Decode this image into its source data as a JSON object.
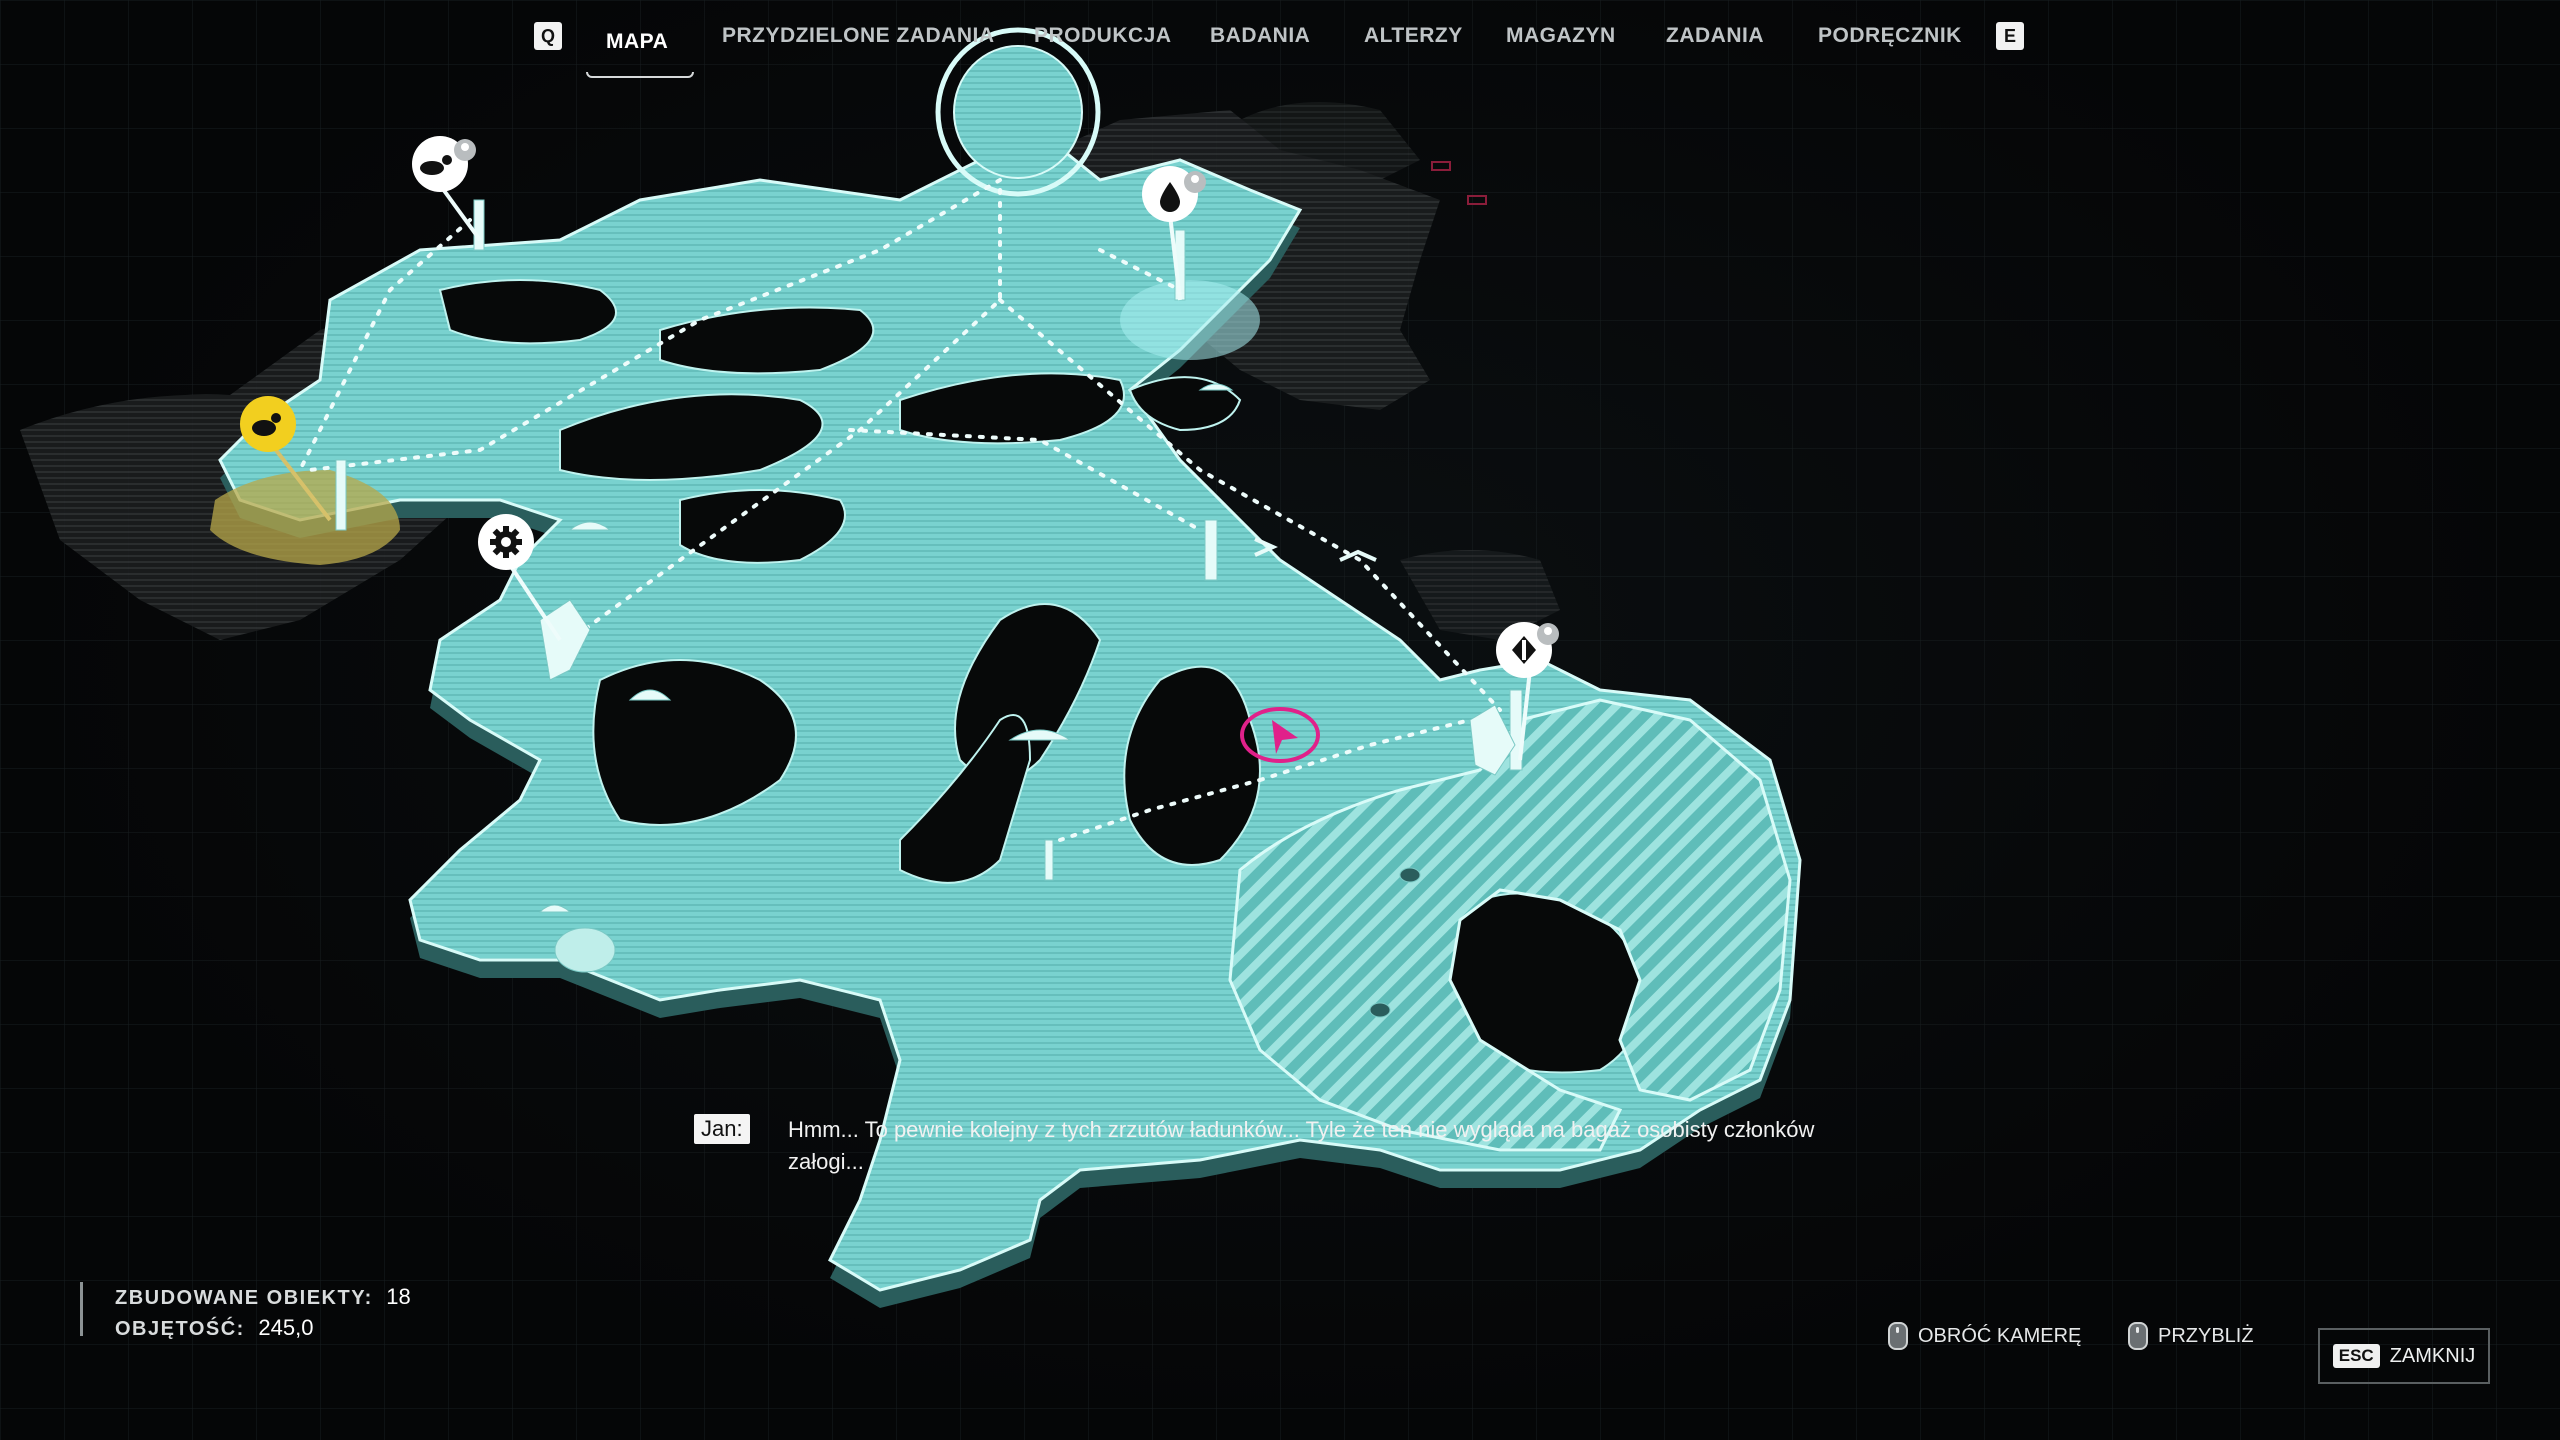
{
  "nav": {
    "left_key": "Q",
    "right_key": "E",
    "tabs": [
      "MAPA",
      "PRZYDZIELONE ZADANIA",
      "PRODUKCJA",
      "BADANIA",
      "ALTERZY",
      "MAGAZYN",
      "ZADANIA",
      "PODRĘCZNIK"
    ],
    "active_tab": "MAPA"
  },
  "map": {
    "markers": [
      {
        "icon": "transport-icon",
        "tag": "worker-icon"
      },
      {
        "icon": "water-drop-icon",
        "tag": "worker-icon"
      },
      {
        "icon": "food-icon",
        "highlight": "yellow"
      },
      {
        "icon": "gear-icon"
      },
      {
        "icon": "diamond-direction-icon",
        "tag": "worker-icon"
      }
    ],
    "player_marker": "player-arrow-icon",
    "colors": {
      "land": "#7fd6d3",
      "outline": "#cffaf6",
      "highlight": "#f2cf1f",
      "player": "#e0218a"
    }
  },
  "subtitle": {
    "speaker": "Jan:",
    "text": "Hmm... To pewnie kolejny z tych zrzutów ładunków... Tyle że ten nie wygląda na bagaż osobisty członków załogi..."
  },
  "stats": {
    "built_label": "ZBUDOWANE OBIEKTY:",
    "built_value": "18",
    "volume_label": "OBJĘTOŚĆ:",
    "volume_value": "245,0"
  },
  "hints": {
    "rotate": "OBRÓĆ KAMERĘ",
    "zoom": "PRZYBLIŻ",
    "close_key": "ESC",
    "close_label": "ZAMKNIJ"
  }
}
